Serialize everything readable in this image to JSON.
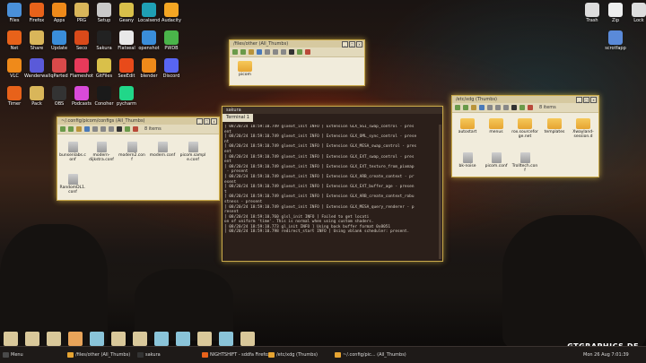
{
  "desktop": {
    "left_icons": [
      {
        "label": "Files",
        "color": "#4a90d9"
      },
      {
        "label": "Firefox",
        "color": "#e8621a"
      },
      {
        "label": "Apps",
        "color": "#ef8a1a"
      },
      {
        "label": "PRG",
        "color": "#d9b65a"
      },
      {
        "label": "Setup",
        "color": "#c9c9c9"
      },
      {
        "label": "Geany",
        "color": "#d9c04a"
      },
      {
        "label": "Localsend",
        "color": "#1fa0b4"
      },
      {
        "label": "Audacity",
        "color": "#f5a623"
      },
      {
        "label": "Net",
        "color": "#e8621a"
      },
      {
        "label": "Share",
        "color": "#d9b65a"
      },
      {
        "label": "Update",
        "color": "#3a8dd9"
      },
      {
        "label": "Seco",
        "color": "#d94a1a"
      },
      {
        "label": "Sakura",
        "color": "#222222"
      },
      {
        "label": "Flatseal",
        "color": "#e8e8e8"
      },
      {
        "label": "openshot",
        "color": "#3a8dd9"
      },
      {
        "label": "PWDB",
        "color": "#4ab44a"
      },
      {
        "label": "VLC",
        "color": "#ef8a1a"
      },
      {
        "label": "Wanderwall",
        "color": "#5a5ad9"
      },
      {
        "label": "qParted",
        "color": "#d94a4a"
      },
      {
        "label": "Flameshot",
        "color": "#e83a5a"
      },
      {
        "label": "GitFiles",
        "color": "#d9c04a"
      },
      {
        "label": "SeeEdit",
        "color": "#e84a1a"
      },
      {
        "label": "blender",
        "color": "#ef8a1a"
      },
      {
        "label": "Discord",
        "color": "#5865f2"
      },
      {
        "label": "Timer",
        "color": "#e8621a"
      },
      {
        "label": "Pack",
        "color": "#d9b65a"
      },
      {
        "label": "OBS",
        "color": "#333333"
      },
      {
        "label": "Podcasts",
        "color": "#d94ad9"
      },
      {
        "label": "Conoher",
        "color": "#1a1a1a"
      },
      {
        "label": "pycharm",
        "color": "#21d789"
      }
    ],
    "right_icons": [
      {
        "label": "Trash",
        "color": "#dddddd"
      },
      {
        "label": "Zip",
        "color": "#eeeeee"
      },
      {
        "label": "Lock",
        "color": "#dddddd"
      },
      {
        "label": "scrotfapp",
        "color": "#5a8ad9"
      }
    ]
  },
  "win_thumbs": {
    "title": "/files/other (All_Thumbs)",
    "items": [
      {
        "label": "picom"
      }
    ]
  },
  "win_picom": {
    "title": "~/.config/picom/configs (All_Thumbs)",
    "count": "8 items",
    "items": [
      {
        "label": "bunsenlabs.conf"
      },
      {
        "label": "modern-dijkstra.conf"
      },
      {
        "label": "modern2.conf"
      },
      {
        "label": "modern.conf"
      },
      {
        "label": "picom.sample.conf"
      },
      {
        "label": "RandomDL1.conf"
      }
    ]
  },
  "win_xdg": {
    "title": "/etc/xdg (Thumbs)",
    "count": "8 items",
    "items": [
      {
        "label": "autostart"
      },
      {
        "label": "menus"
      },
      {
        "label": "rox.sourceforge.net"
      },
      {
        "label": "templates"
      },
      {
        "label": "Xwayland-session.d"
      },
      {
        "label": "bk-noise"
      },
      {
        "label": "picom.conf"
      },
      {
        "label": "Trolltech.conf"
      }
    ]
  },
  "terminal": {
    "title": "sakura",
    "tab": "Terminal 1",
    "lines": [
      "[ 08/20/24 18:59:10.749 glxext_init INFO ] Extension GLX_SGI_swap_control - pres",
      "ent",
      "[ 08/20/24 18:59:10.749 glxext_init INFO ] Extension GLX_OML_sync_control - prese",
      "nt",
      "[ 08/20/24 18:59:10.749 glxext_init INFO ] Extension GLX_MESA_swap_control - pres",
      "ent",
      "[ 08/20/24 18:59:10.749 glxext_init INFO ] Extension GLX_EXT_swap_control - pres",
      "ent",
      "[ 08/20/24 18:59:10.749 glxext_init INFO ] Extension GLX_EXT_texture_from_pixmap",
      " - present",
      "[ 08/20/24 18:59:10.749 glxext_init INFO ] Extension GLX_ARB_create_context - pr",
      "esent",
      "[ 08/20/24 18:59:10.749 glxext_init INFO ] Extension GLX_EXT_buffer_age - presen",
      "t",
      "[ 08/20/24 18:59:10.749 glxext_init INFO ] Extension GLX_ARB_create_context_robu",
      "stness - present",
      "[ 08/20/24 18:59:10.749 glxext_init INFO ] Extension GLX_MESA_query_renderer - p",
      "resent",
      "[ 08/20/24 18:59:10.760 glsl_init INFO ] Failed to get locati",
      "on of uniform 'time'. This is normal when using custom shaders.",
      "[ 08/20/24 18:59:10.773 gl_init INFO ] Using back buffer format 0x8051",
      "[ 08/20/24 18:59:10.798 redirect_start INFO ] Using vblank scheduler: present."
    ]
  },
  "taskbar": {
    "menu_label": "Menu",
    "tasks": [
      {
        "label": "/files/other (All_Thumbs)"
      },
      {
        "label": "sakura"
      },
      {
        "label": "NIGHTSHIFT - sddfa Firefox"
      },
      {
        "label": "/etc/xdg (Thumbs)"
      },
      {
        "label": "~/.config/pic... (All_Thumbs)"
      }
    ],
    "clock": "Mon 26 Aug  7:01:39"
  },
  "brand": "GTGRAPHICS.DE",
  "dock_colors": [
    "#d9c89a",
    "#d9c89a",
    "#d9c89a",
    "#e8a45a",
    "#8ac4d9",
    "#d9c89a",
    "#d9c89a",
    "#8ac4d9",
    "#8ac4d9",
    "#d9c89a",
    "#8ac4d9",
    "#d9c89a"
  ]
}
